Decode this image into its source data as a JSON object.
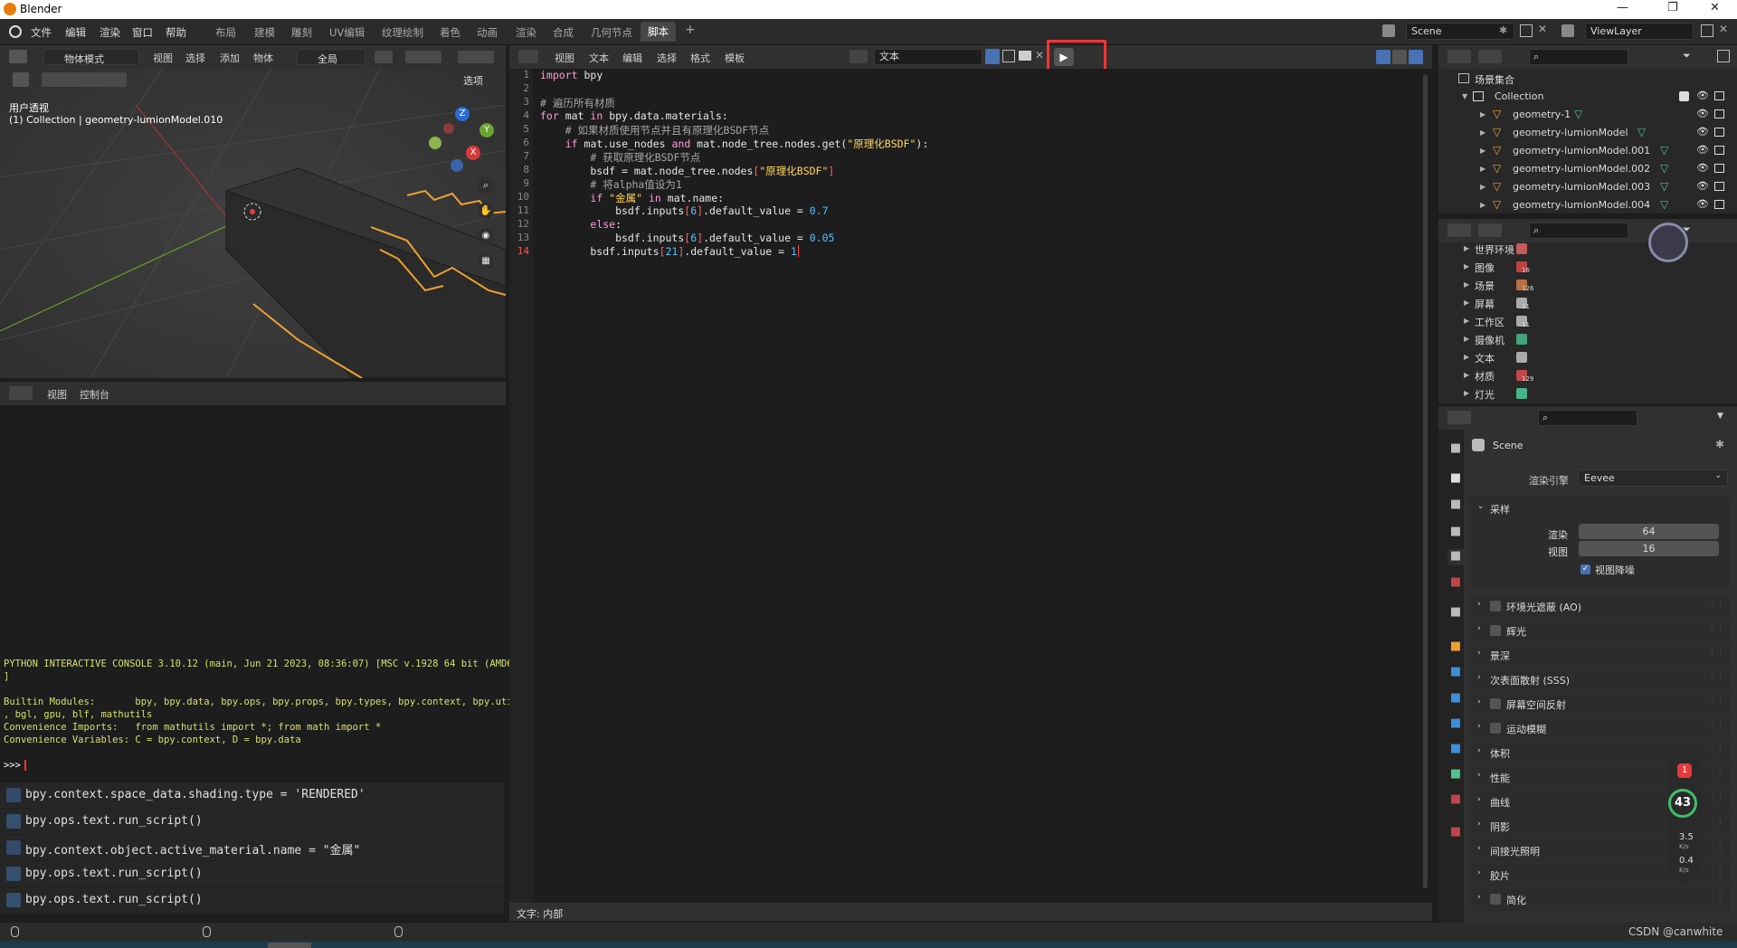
{
  "window": {
    "title": "Blender",
    "controls": [
      "—",
      "❐",
      "✕"
    ]
  },
  "menus": [
    "文件",
    "编辑",
    "渲染",
    "窗口",
    "帮助"
  ],
  "workspaces": [
    "布局",
    "建模",
    "雕刻",
    "UV编辑",
    "纹理绘制",
    "着色",
    "动画",
    "渲染",
    "合成",
    "几何节点",
    "脚本"
  ],
  "active_workspace": "脚本",
  "add_tab": "+",
  "scene_field": "Scene",
  "viewlayer_field": "ViewLayer",
  "viewport": {
    "mode": "物体模式",
    "menu": [
      "视图",
      "选择",
      "添加",
      "物体"
    ],
    "transform": "全局",
    "options": "选项",
    "overlay_title": "用户透视",
    "overlay_sub": "(1) Collection | geometry-lumionModel.010",
    "gizmo_axes": [
      "Z",
      "Y",
      "X"
    ]
  },
  "console": {
    "header_menu": [
      "视图",
      "控制台"
    ],
    "lines": [
      "PYTHON INTERACTIVE CONSOLE 3.10.12 (main, Jun 21 2023, 08:36:07) [MSC v.1928 64 bit (AMD64)",
      "]",
      "",
      "Builtin Modules:       bpy, bpy.data, bpy.ops, bpy.props, bpy.types, bpy.context, bpy.utils",
      ", bgl, gpu, blf, mathutils",
      "Convenience Imports:   from mathutils import *; from math import *",
      "Convenience Variables: C = bpy.context, D = bpy.data"
    ],
    "prompt": ">>> "
  },
  "info_log": [
    {
      "text": "bpy.context.space_data.shading.type = 'RENDERED'",
      "kind": "property"
    },
    {
      "text": "bpy.ops.text.run_script()",
      "kind": "operator"
    },
    {
      "text": "bpy.context.object.active_material.name = \"金属\"",
      "kind": "property"
    },
    {
      "text": "bpy.ops.text.run_script()",
      "kind": "operator"
    },
    {
      "text": "bpy.ops.text.run_script()",
      "kind": "operator"
    }
  ],
  "text_editor": {
    "menu": [
      "视图",
      "文本",
      "编辑",
      "选择",
      "格式",
      "模板"
    ],
    "text_name": "文本",
    "run_button": "▶",
    "status": "文字: 内部",
    "line_numbers": [
      "1",
      "2",
      "3",
      "4",
      "5",
      "6",
      "7",
      "8",
      "9",
      "10",
      "11",
      "12",
      "13",
      "14"
    ],
    "current_line": "14"
  },
  "outliner": {
    "root": "场景集合",
    "collection": "Collection",
    "objects": [
      "geometry-1",
      "geometry-lumionModel",
      "geometry-lumionModel.001",
      "geometry-lumionModel.002",
      "geometry-lumionModel.003",
      "geometry-lumionModel.004"
    ]
  },
  "blend_data": [
    {
      "label": "世界环境",
      "count": ""
    },
    {
      "label": "图像",
      "count": "16"
    },
    {
      "label": "场景",
      "count": "126"
    },
    {
      "label": "屏幕",
      "count": "11"
    },
    {
      "label": "工作区",
      "count": "11"
    },
    {
      "label": "摄像机",
      "count": ""
    },
    {
      "label": "文本",
      "count": ""
    },
    {
      "label": "材质",
      "count": "129"
    },
    {
      "label": "灯光",
      "count": ""
    }
  ],
  "properties": {
    "scene_name": "Scene",
    "render_engine_label": "渲染引擎",
    "render_engine": "Eevee",
    "sampling": {
      "title": "采样",
      "render_label": "渲染",
      "render_value": "64",
      "viewport_label": "视图",
      "viewport_value": "16",
      "denoise_label": "视图降噪"
    },
    "panels": [
      {
        "label": "环境光遮蔽 (AO)",
        "checkbox": true
      },
      {
        "label": "辉光",
        "checkbox": true
      },
      {
        "label": "景深",
        "checkbox": false
      },
      {
        "label": "次表面散射 (SSS)",
        "checkbox": false
      },
      {
        "label": "屏幕空间反射",
        "checkbox": true
      },
      {
        "label": "运动模糊",
        "checkbox": true
      },
      {
        "label": "体积",
        "checkbox": false
      },
      {
        "label": "性能",
        "checkbox": false
      },
      {
        "label": "曲线",
        "checkbox": false
      },
      {
        "label": "阴影",
        "checkbox": false
      },
      {
        "label": "间接光照明",
        "checkbox": false
      },
      {
        "label": "胶片",
        "checkbox": false
      },
      {
        "label": "简化",
        "checkbox": true
      }
    ]
  },
  "overlay_widget": {
    "badge": "1",
    "percent": "43",
    "up": "3.5",
    "down": "0.4",
    "unit": "K/s"
  },
  "watermark": "CSDN @canwhite",
  "colors": {
    "accent": "#4772b3",
    "highlight": "#ff3333",
    "selected_orange": "#f0a030"
  }
}
